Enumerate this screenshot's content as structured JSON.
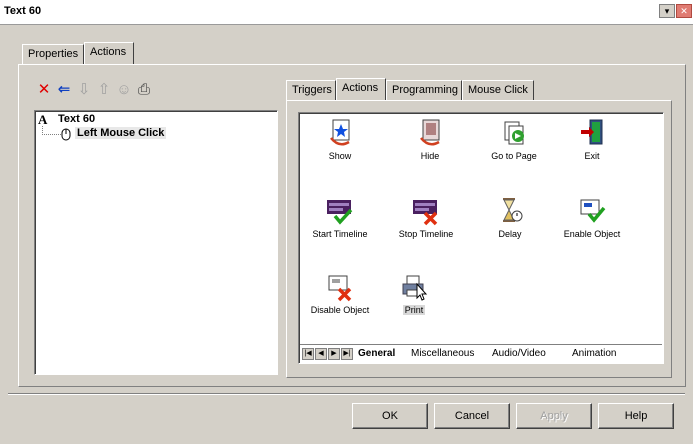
{
  "window": {
    "title": "Text 60",
    "minimize_glyph": "▾",
    "close_glyph": "✕"
  },
  "outer_tabs": [
    "Properties",
    "Actions"
  ],
  "toolbar": {
    "delete_glyph": "✕",
    "back_glyph": "⇐",
    "down_glyph": "⇩",
    "up_glyph": "⇧",
    "people_glyph": "☺",
    "print_glyph": "⎙"
  },
  "tree": {
    "root_prefix": "A",
    "root_label": "Text 60",
    "child_label": "Left Mouse Click"
  },
  "inner_tabs": [
    "Triggers",
    "Actions",
    "Programming",
    "Mouse Click"
  ],
  "actions": [
    {
      "label": "Show",
      "icon": "show-icon"
    },
    {
      "label": "Hide",
      "icon": "hide-icon"
    },
    {
      "label": "Go to Page",
      "icon": "goto-page-icon"
    },
    {
      "label": "Exit",
      "icon": "exit-icon"
    },
    {
      "label": "Start Timeline",
      "icon": "start-timeline-icon"
    },
    {
      "label": "Stop Timeline",
      "icon": "stop-timeline-icon"
    },
    {
      "label": "Delay",
      "icon": "hourglass-icon"
    },
    {
      "label": "Enable Object",
      "icon": "enable-object-icon"
    },
    {
      "label": "Disable Object",
      "icon": "disable-object-icon"
    },
    {
      "label": "Print",
      "icon": "printer-icon"
    }
  ],
  "category_tabs": [
    "General",
    "Miscellaneous",
    "Audio/Video",
    "Animation"
  ],
  "nav_glyphs": [
    "|◀",
    "◀",
    "▶",
    "▶|"
  ],
  "buttons": {
    "ok": "OK",
    "cancel": "Cancel",
    "apply": "Apply",
    "help": "Help"
  },
  "colors": {
    "delete_red": "#e00000",
    "back_blue": "#1040c0",
    "check_green": "#20a020",
    "exit_red": "#c00000"
  }
}
